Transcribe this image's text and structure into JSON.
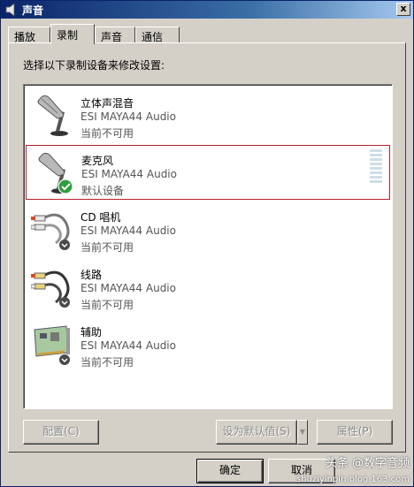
{
  "window": {
    "title": "声音",
    "close_label": "x"
  },
  "tabs": [
    {
      "label": "播放"
    },
    {
      "label": "录制"
    },
    {
      "label": "声音"
    },
    {
      "label": "通信"
    }
  ],
  "panel": {
    "instruction": "选择以下录制设备来修改设置:"
  },
  "devices": [
    {
      "name": "立体声混音",
      "driver": "ESI MAYA44 Audio",
      "status": "当前不可用",
      "icon": "microphone-icon"
    },
    {
      "name": "麦克风",
      "driver": "ESI MAYA44 Audio",
      "status": "默认设备",
      "icon": "microphone-default-icon"
    },
    {
      "name": "CD 唱机",
      "driver": "ESI MAYA44 Audio",
      "status": "当前不可用",
      "icon": "cd-cable-icon"
    },
    {
      "name": "线路",
      "driver": "ESI MAYA44 Audio",
      "status": "当前不可用",
      "icon": "line-cable-icon"
    },
    {
      "name": "辅助",
      "driver": "ESI MAYA44 Audio",
      "status": "当前不可用",
      "icon": "sound-card-icon"
    }
  ],
  "buttons": {
    "configure": "配置(C)",
    "set_default": "设为默认值(S)",
    "properties": "属性(P)",
    "ok": "确定",
    "cancel": "取消"
  },
  "watermark": {
    "text": "头条 @数字音频",
    "url": "shuziyinpin.blog.163.com"
  },
  "colors": {
    "selection_border": "#b8202e",
    "title_bar": "#0a246a"
  }
}
